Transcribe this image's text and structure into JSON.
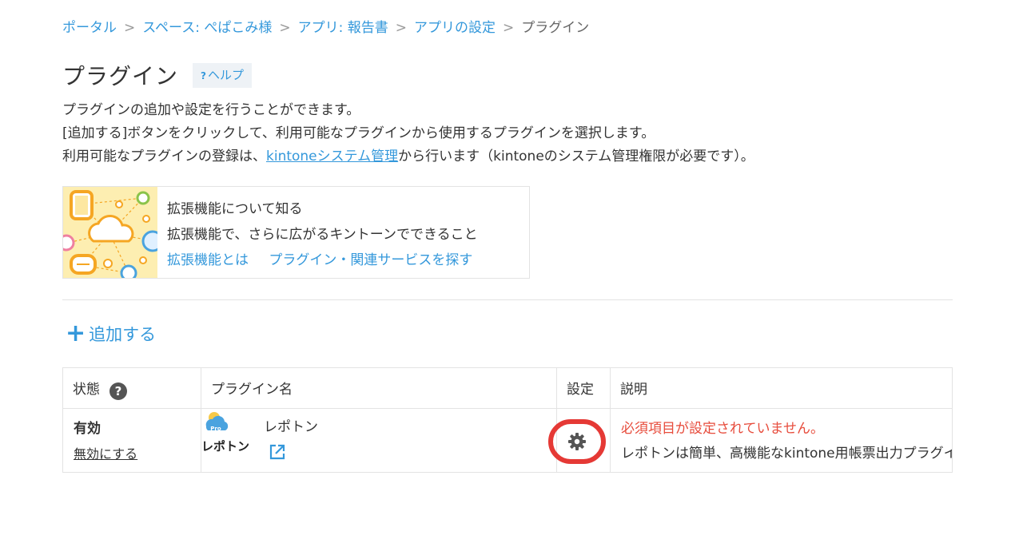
{
  "breadcrumb": {
    "items": [
      "ポータル",
      "スペース: ぺぱこみ様",
      "アプリ: 報告書",
      "アプリの設定",
      "プラグイン"
    ],
    "separator": ">"
  },
  "page": {
    "title": "プラグイン",
    "help_mark": "?",
    "help_label": "ヘルプ"
  },
  "description": {
    "line1": "プラグインの追加や設定を行うことができます。",
    "line2": "[追加する]ボタンをクリックして、利用可能なプラグインから使用するプラグインを選択します。",
    "line3_prefix": "利用可能なプラグインの登録は、",
    "line3_link": "kintoneシステム管理",
    "line3_suffix": "から行います（kintoneのシステム管理権限が必要です）。"
  },
  "extension_box": {
    "title": "拡張機能について知る",
    "subtitle": "拡張機能で、さらに広がるキントーンでできること",
    "link1": "拡張機能とは",
    "link2": "プラグイン・関連サービスを探す"
  },
  "add_button": {
    "icon": "+",
    "label": "追加する"
  },
  "table": {
    "headers": {
      "status": "状態",
      "status_help": "?",
      "plugin_name": "プラグイン名",
      "settings": "設定",
      "description": "説明"
    },
    "rows": [
      {
        "status": "有効",
        "disable_link": "無効にする",
        "plugin_name": "レポトン",
        "logo_text": "レポトン",
        "logo_badge": "Pro",
        "error_text": "必須項目が設定されていません。",
        "description": "レポトンは簡単、高機能なkintone用帳票出力プラグインです。"
      }
    ]
  },
  "colors": {
    "link": "#3498db",
    "error": "#e74c3c",
    "highlight_ring": "#e53935",
    "banner_bg": "#fdeeb1"
  }
}
